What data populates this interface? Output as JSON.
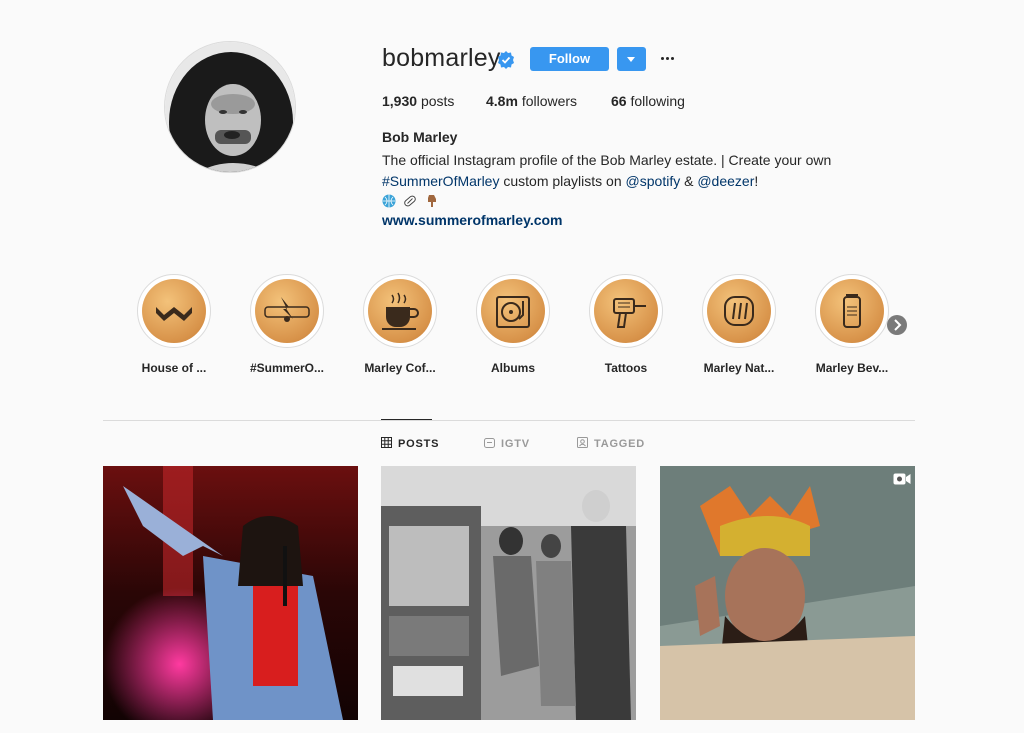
{
  "profile": {
    "username": "bobmarley",
    "follow_label": "Follow",
    "posts_count": "1,930",
    "posts_label": "posts",
    "followers_count": "4.8m",
    "followers_label": "followers",
    "following_count": "66",
    "following_label": "following",
    "full_name": "Bob Marley",
    "bio_line1": "The official Instagram profile of the Bob Marley estate. | Create your own",
    "bio_hashtag": "#SummerOfMarley",
    "bio_mid": " custom playlists on ",
    "bio_mention1": "@spotify",
    "bio_amp": " & ",
    "bio_mention2": "@deezer",
    "bio_end": "!",
    "website": "www.summerofmarley.com",
    "emojis": [
      "globe-icon",
      "pill-icon",
      "pointing-down-hand-icon"
    ]
  },
  "highlights": [
    {
      "label": "House of ...",
      "icon": "marley-logo-icon"
    },
    {
      "label": "#SummerO...",
      "icon": "summer-of-marley-logo-icon"
    },
    {
      "label": "Marley Cof...",
      "icon": "coffee-cup-icon"
    },
    {
      "label": "Albums",
      "icon": "turntable-icon"
    },
    {
      "label": "Tattoos",
      "icon": "tattoo-gun-icon"
    },
    {
      "label": "Marley Nat...",
      "icon": "marley-natural-logo-icon"
    },
    {
      "label": "Marley Bev...",
      "icon": "beverage-can-icon"
    }
  ],
  "tabs": [
    {
      "label": "POSTS",
      "icon": "grid-icon",
      "active": true
    },
    {
      "label": "IGTV",
      "icon": "igtv-icon",
      "active": false
    },
    {
      "label": "TAGGED",
      "icon": "tagged-icon",
      "active": false
    }
  ],
  "colors": {
    "accent": "#3897f0",
    "link": "#003569",
    "text": "#262626",
    "muted": "#999999"
  }
}
